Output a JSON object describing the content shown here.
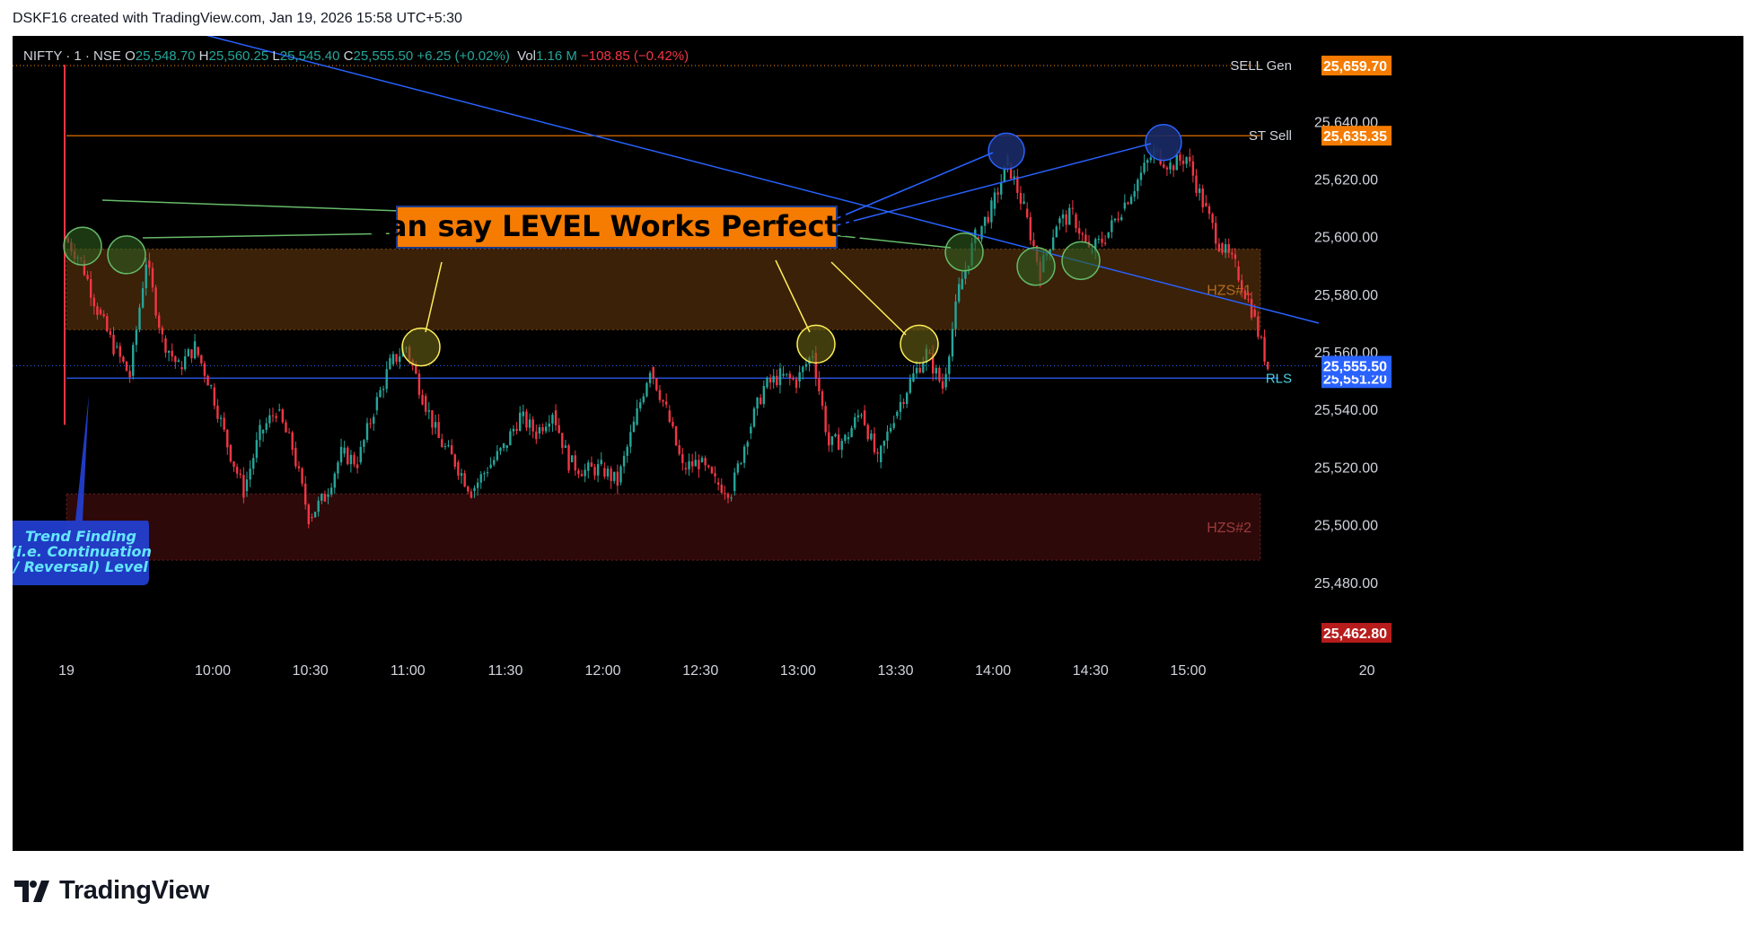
{
  "header": {
    "text": "DSKF16 created with TradingView.com, Jan 19, 2026 15:58 UTC+5:30"
  },
  "legend": {
    "symbol": "NIFTY · 1 · NSE",
    "open_label": "O",
    "open": "25,548.70",
    "high_label": "H",
    "high": "25,560.25",
    "low_label": "L",
    "low": "25,545.40",
    "close_label": "C",
    "close": "25,555.50",
    "change": "+6.25 (+0.02%)",
    "vol_label": "Vol",
    "vol": "1.16 M",
    "vol_change": "−108.85 (−0.42%)"
  },
  "colors": {
    "up": "#26a69a",
    "down": "#f23645",
    "background": "#000000",
    "orange_tag": "#f57c00",
    "blue_tag": "#2962ff",
    "dark_red_tag": "#b71c1c",
    "trendline": "#2962ff",
    "annotation_green": "#66bb6a",
    "annotation_yellow": "#ffee58"
  },
  "chart_data": {
    "type": "candlestick",
    "symbol": "NIFTY",
    "timeframe": "1",
    "exchange": "NSE",
    "x_ticks": [
      "19",
      "10:00",
      "10:30",
      "11:00",
      "11:30",
      "12:00",
      "12:30",
      "13:00",
      "13:30",
      "14:00",
      "14:30",
      "15:00",
      "20"
    ],
    "y_ticks": [
      "25,640.00",
      "25,620.00",
      "25,600.00",
      "25,580.00",
      "25,560.00",
      "25,540.00",
      "25,520.00",
      "25,500.00",
      "25,480.00"
    ],
    "ylim": [
      25455,
      25670
    ],
    "series": [
      {
        "x": "09:15",
        "close": 25600
      },
      {
        "x": "09:20",
        "close": 25592
      },
      {
        "x": "09:25",
        "close": 25575
      },
      {
        "x": "09:30",
        "close": 25562
      },
      {
        "x": "09:35",
        "close": 25552
      },
      {
        "x": "09:40",
        "close": 25592
      },
      {
        "x": "09:45",
        "close": 25565
      },
      {
        "x": "09:50",
        "close": 25555
      },
      {
        "x": "09:55",
        "close": 25562
      },
      {
        "x": "10:00",
        "close": 25548
      },
      {
        "x": "10:05",
        "close": 25528
      },
      {
        "x": "10:10",
        "close": 25512
      },
      {
        "x": "10:15",
        "close": 25532
      },
      {
        "x": "10:20",
        "close": 25540
      },
      {
        "x": "10:25",
        "close": 25527
      },
      {
        "x": "10:30",
        "close": 25503
      },
      {
        "x": "10:35",
        "close": 25510
      },
      {
        "x": "10:40",
        "close": 25525
      },
      {
        "x": "10:45",
        "close": 25522
      },
      {
        "x": "10:50",
        "close": 25540
      },
      {
        "x": "10:55",
        "close": 25556
      },
      {
        "x": "11:00",
        "close": 25562
      },
      {
        "x": "11:05",
        "close": 25545
      },
      {
        "x": "11:10",
        "close": 25530
      },
      {
        "x": "11:15",
        "close": 25522
      },
      {
        "x": "11:20",
        "close": 25512
      },
      {
        "x": "11:25",
        "close": 25520
      },
      {
        "x": "11:30",
        "close": 25527
      },
      {
        "x": "11:35",
        "close": 25538
      },
      {
        "x": "11:40",
        "close": 25532
      },
      {
        "x": "11:45",
        "close": 25540
      },
      {
        "x": "11:50",
        "close": 25522
      },
      {
        "x": "11:55",
        "close": 25519
      },
      {
        "x": "12:00",
        "close": 25520
      },
      {
        "x": "12:05",
        "close": 25515
      },
      {
        "x": "12:10",
        "close": 25535
      },
      {
        "x": "12:15",
        "close": 25555
      },
      {
        "x": "12:20",
        "close": 25540
      },
      {
        "x": "12:25",
        "close": 25520
      },
      {
        "x": "12:30",
        "close": 25522
      },
      {
        "x": "12:35",
        "close": 25515
      },
      {
        "x": "12:40",
        "close": 25512
      },
      {
        "x": "12:45",
        "close": 25532
      },
      {
        "x": "12:50",
        "close": 25548
      },
      {
        "x": "12:55",
        "close": 25552
      },
      {
        "x": "13:00",
        "close": 25550
      },
      {
        "x": "13:05",
        "close": 25560
      },
      {
        "x": "13:10",
        "close": 25528
      },
      {
        "x": "13:15",
        "close": 25530
      },
      {
        "x": "13:20",
        "close": 25540
      },
      {
        "x": "13:25",
        "close": 25522
      },
      {
        "x": "13:30",
        "close": 25538
      },
      {
        "x": "13:35",
        "close": 25550
      },
      {
        "x": "13:40",
        "close": 25560
      },
      {
        "x": "13:45",
        "close": 25548
      },
      {
        "x": "13:50",
        "close": 25582
      },
      {
        "x": "13:55",
        "close": 25600
      },
      {
        "x": "14:00",
        "close": 25610
      },
      {
        "x": "14:05",
        "close": 25626
      },
      {
        "x": "14:10",
        "close": 25610
      },
      {
        "x": "14:15",
        "close": 25588
      },
      {
        "x": "14:20",
        "close": 25605
      },
      {
        "x": "14:25",
        "close": 25608
      },
      {
        "x": "14:30",
        "close": 25595
      },
      {
        "x": "14:35",
        "close": 25600
      },
      {
        "x": "14:40",
        "close": 25610
      },
      {
        "x": "14:45",
        "close": 25620
      },
      {
        "x": "14:50",
        "close": 25630
      },
      {
        "x": "14:55",
        "close": 25625
      },
      {
        "x": "15:00",
        "close": 25628
      },
      {
        "x": "15:05",
        "close": 25612
      },
      {
        "x": "15:10",
        "close": 25598
      },
      {
        "x": "15:15",
        "close": 25590
      },
      {
        "x": "15:20",
        "close": 25575
      },
      {
        "x": "15:25",
        "close": 25555
      }
    ],
    "zones": [
      {
        "label": "HZS#1",
        "low": 25568,
        "high": 25596,
        "color": "#3a2108",
        "label_color": "#b36a1e"
      },
      {
        "label": "HZS#2",
        "low": 25488,
        "high": 25511,
        "color": "#2e0909",
        "label_color": "#9a3b3b"
      }
    ],
    "levels": [
      {
        "label": "SELL Gen",
        "value": "25,659.70",
        "numeric": 25659.7,
        "tag_color": "#f57c00",
        "style": "dotted"
      },
      {
        "label": "ST Sell",
        "value": "25,635.35",
        "numeric": 25635.35,
        "tag_color": "#f57c00",
        "style": "solid"
      },
      {
        "label": "RLS",
        "value": "25,551.20",
        "numeric": 25551.2,
        "tag_color": "#2962ff",
        "style": "solid"
      }
    ],
    "price_tags": [
      {
        "value": "25,555.50",
        "numeric": 25555.5,
        "color": "#2962ff"
      },
      {
        "value": "25,462.80",
        "numeric": 25462.8,
        "color": "#b71c1c"
      }
    ],
    "annotations": {
      "headline": "Can say LEVEL Works Perfectly",
      "left_box": "Trend Finding (i.e. Continuation / Reversal) Level",
      "left_box_lines": [
        "Trend Finding",
        "(i.e. Continuation",
        "/ Reversal) Level"
      ]
    },
    "grid": false,
    "legend": "top-left"
  },
  "footer": {
    "brand": "TradingView"
  }
}
